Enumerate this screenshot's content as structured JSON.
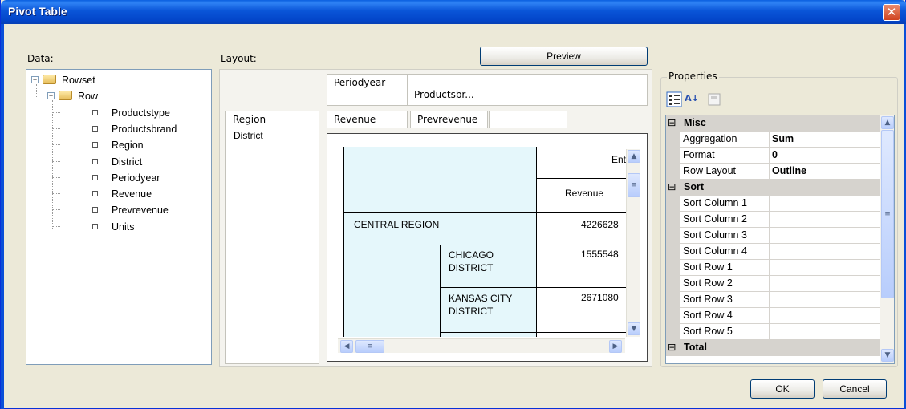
{
  "window": {
    "title": "Pivot Table",
    "close_symbol": "✕"
  },
  "data_panel": {
    "label": "Data:",
    "tree": [
      {
        "label": "Rowset",
        "icon": "folder-icon",
        "expanded": true
      },
      {
        "label": "Row",
        "icon": "folder-icon",
        "expanded": true
      },
      {
        "label": "Productstype",
        "icon": "field-icon"
      },
      {
        "label": "Productsbrand",
        "icon": "field-icon"
      },
      {
        "label": "Region",
        "icon": "field-icon"
      },
      {
        "label": "District",
        "icon": "field-icon"
      },
      {
        "label": "Periodyear",
        "icon": "field-icon"
      },
      {
        "label": "Revenue",
        "icon": "field-icon"
      },
      {
        "label": "Prevrevenue",
        "icon": "field-icon"
      },
      {
        "label": "Units",
        "icon": "field-icon"
      }
    ]
  },
  "layout": {
    "label": "Layout:",
    "preview_button": "Preview",
    "column_fields": [
      "Periodyear",
      "Productsbr..."
    ],
    "row_fields": [
      "Region",
      "District"
    ],
    "data_fields": [
      "Revenue",
      "Prevrevenue",
      ""
    ],
    "preview_grid": {
      "col_header_top": "Ent",
      "col_header_measure": "Revenue",
      "rows": [
        {
          "label": "CENTRAL REGION",
          "value": "4226628"
        },
        {
          "label": "CHICAGO DISTRICT",
          "value": "1555548"
        },
        {
          "label": "KANSAS CITY DISTRICT",
          "value": "2671080"
        }
      ]
    }
  },
  "properties": {
    "label": "Properties",
    "toolbar": [
      "categorized-icon",
      "alphabetical-sort-icon",
      "property-pages-icon"
    ],
    "categories": [
      {
        "name": "Misc",
        "items": [
          {
            "name": "Aggregation",
            "value": "Sum"
          },
          {
            "name": "Format",
            "value": "0"
          },
          {
            "name": "Row Layout",
            "value": "Outline"
          }
        ]
      },
      {
        "name": "Sort",
        "items": [
          {
            "name": "Sort Column 1",
            "value": ""
          },
          {
            "name": "Sort Column 2",
            "value": ""
          },
          {
            "name": "Sort Column 3",
            "value": ""
          },
          {
            "name": "Sort Column 4",
            "value": ""
          },
          {
            "name": "Sort Row 1",
            "value": ""
          },
          {
            "name": "Sort Row 2",
            "value": ""
          },
          {
            "name": "Sort Row 3",
            "value": ""
          },
          {
            "name": "Sort Row 4",
            "value": ""
          },
          {
            "name": "Sort Row 5",
            "value": ""
          }
        ]
      },
      {
        "name": "Total",
        "items": []
      }
    ],
    "collapse_symbol": "⊟"
  },
  "buttons": {
    "ok": "OK",
    "cancel": "Cancel"
  }
}
